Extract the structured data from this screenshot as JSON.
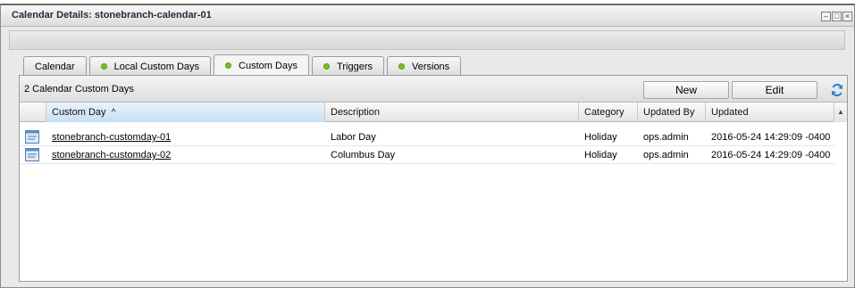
{
  "window": {
    "title": "Calendar Details: stonebranch-calendar-01",
    "controls": [
      "minimize",
      "restore",
      "close"
    ]
  },
  "tabs": [
    {
      "label": "Calendar",
      "dot": false,
      "active": false
    },
    {
      "label": "Local Custom Days",
      "dot": true,
      "active": false
    },
    {
      "label": "Custom Days",
      "dot": true,
      "active": true
    },
    {
      "label": "Triggers",
      "dot": true,
      "active": false
    },
    {
      "label": "Versions",
      "dot": true,
      "active": false
    }
  ],
  "panel": {
    "count_label": "2 Calendar Custom Days",
    "new_button": "New",
    "edit_button": "Edit"
  },
  "grid": {
    "columns": [
      "Custom Day",
      "Description",
      "Category",
      "Updated By",
      "Updated"
    ],
    "sort_indicator": "^",
    "rows": [
      {
        "custom_day": "stonebranch-customday-01",
        "description": "Labor Day",
        "category": "Holiday",
        "updated_by": "ops.admin",
        "updated": "2016-05-24 14:29:09 -0400"
      },
      {
        "custom_day": "stonebranch-customday-02",
        "description": "Columbus Day",
        "category": "Holiday",
        "updated_by": "ops.admin",
        "updated": "2016-05-24 14:29:09 -0400"
      }
    ]
  },
  "colors": {
    "active_dot": "#7dbf22",
    "sorted_header": "#c8dff3"
  }
}
